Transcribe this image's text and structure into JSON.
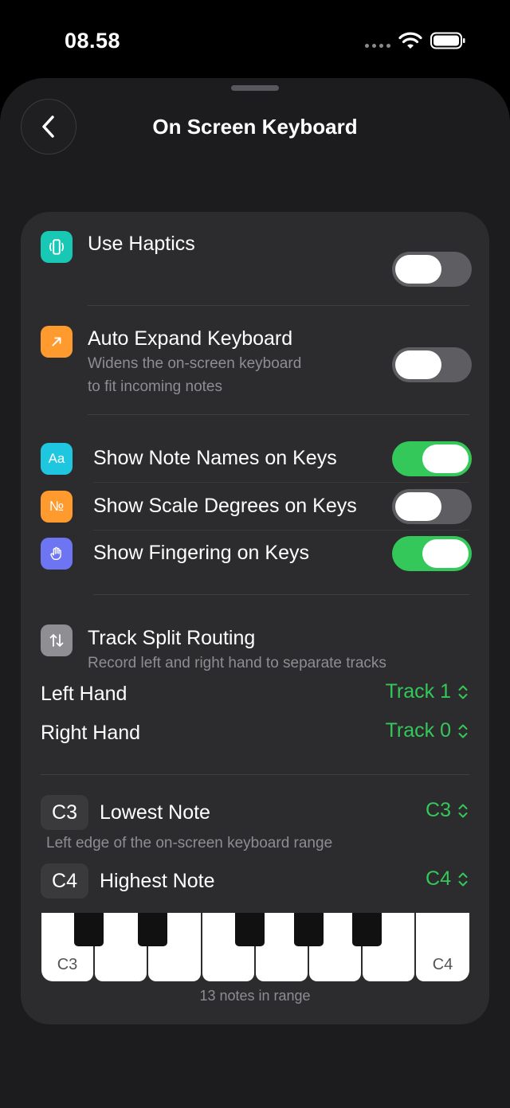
{
  "status_bar": {
    "time": "08.58"
  },
  "nav": {
    "title": "On Screen Keyboard",
    "back_icon": "chevron-left-icon"
  },
  "settings": {
    "use_haptics": {
      "title": "Use Haptics",
      "icon": "haptics-phone-icon",
      "icon_color": "#19c8b4",
      "enabled": false
    },
    "auto_expand": {
      "title": "Auto Expand Keyboard",
      "subtitle_line1": "Widens the on-screen keyboard",
      "subtitle_line2": "to fit incoming notes",
      "icon": "arrow-up-right-icon",
      "icon_color": "#ff9a2e",
      "enabled": false
    },
    "note_names": {
      "title": "Show Note Names on Keys",
      "icon_text": "Aa",
      "icon_color": "#1fc6e0",
      "enabled": true
    },
    "scale_degrees": {
      "title": "Show Scale Degrees on Keys",
      "icon_text": "№",
      "icon_color": "#ff9a2e",
      "enabled": false
    },
    "fingering": {
      "title": "Show Fingering on Keys",
      "icon": "hand-icon",
      "icon_color": "#6e75f2",
      "enabled": true
    }
  },
  "track_split": {
    "title": "Track Split Routing",
    "subtitle": "Record left and right hand to separate tracks",
    "icon": "arrows-up-down-icon",
    "left_hand": {
      "label": "Left Hand",
      "value": "Track 1"
    },
    "right_hand": {
      "label": "Right Hand",
      "value": "Track 0"
    }
  },
  "range": {
    "lowest": {
      "badge": "C3",
      "label": "Lowest Note",
      "value": "C3",
      "subtitle": "Left edge of the on-screen keyboard range"
    },
    "highest": {
      "badge": "C4",
      "label": "Highest Note",
      "value": "C4"
    },
    "keyboard": {
      "first_key_label": "C3",
      "last_key_label": "C4",
      "caption": "13 notes in range"
    }
  },
  "colors": {
    "accent_green": "#34c759",
    "card": "#2c2c2e",
    "background": "#1c1c1e"
  }
}
